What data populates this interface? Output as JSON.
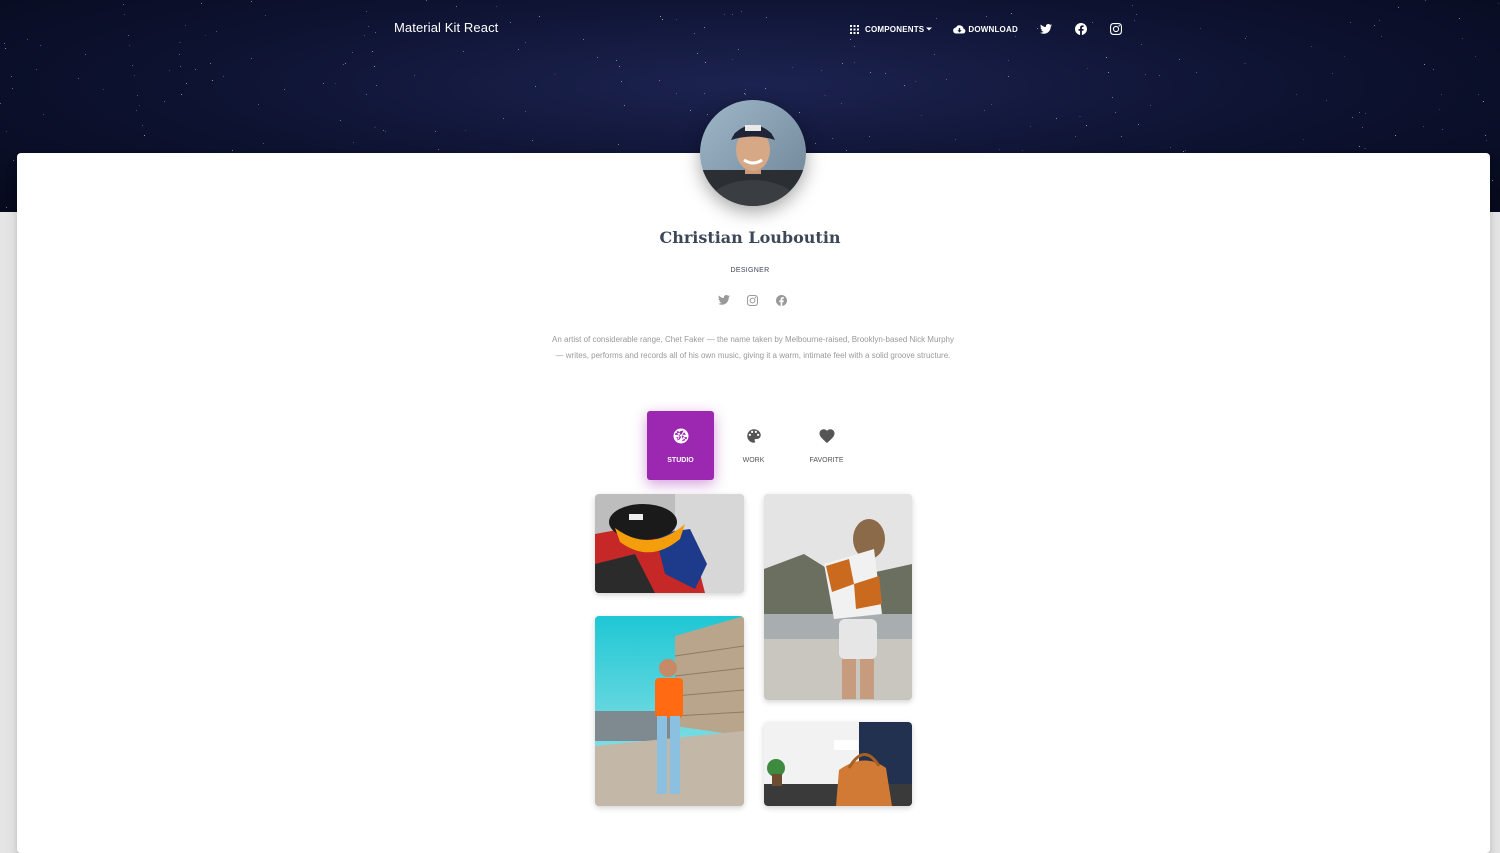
{
  "header": {
    "brand": "Material Kit React",
    "nav": {
      "components_label": "COMPONENTS",
      "download_label": "DOWNLOAD",
      "icons": [
        "twitter-icon",
        "facebook-icon",
        "instagram-icon"
      ]
    }
  },
  "profile": {
    "name": "Christian Louboutin",
    "role": "DESIGNER",
    "social_icons": [
      "twitter-icon",
      "instagram-icon",
      "facebook-icon"
    ],
    "bio": "An artist of considerable range, Chet Faker — the name taken by Melbourne-raised, Brooklyn-based Nick Murphy — writes, performs and records all of his own music, giving it a warm, intimate feel with a solid groove structure."
  },
  "tabs": [
    {
      "label": "STUDIO",
      "icon": "camera-aperture-icon",
      "active": true
    },
    {
      "label": "WORK",
      "icon": "palette-icon",
      "active": false
    },
    {
      "label": "FAVORITE",
      "icon": "heart-icon",
      "active": false
    }
  ],
  "colors": {
    "accent": "#9c27b0",
    "hero_bg": "#0d1230",
    "title": "#3c4858",
    "muted": "#999999"
  }
}
